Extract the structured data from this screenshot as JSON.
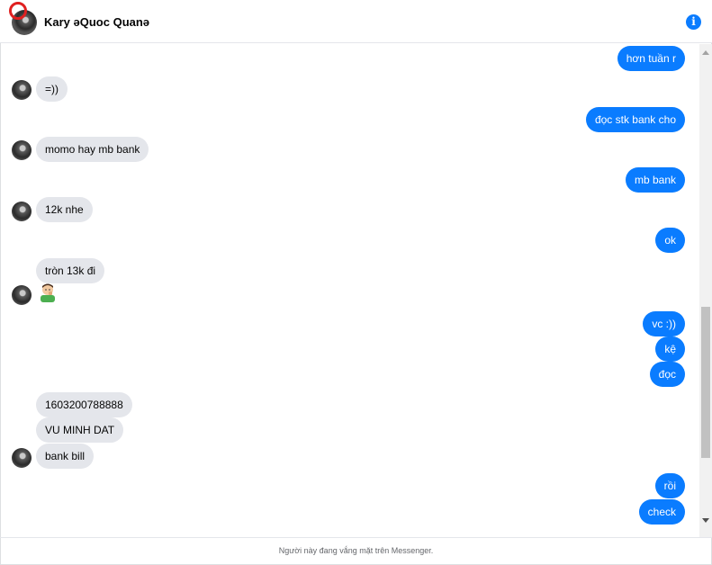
{
  "header": {
    "contact_name": "Kary ǝQuoc Quanǝ",
    "info_icon": "info-icon",
    "info_glyph": "i"
  },
  "messages": [
    {
      "side": "out",
      "text": "hơn tuần r"
    },
    {
      "side": "in",
      "text": "=))"
    },
    {
      "side": "out",
      "text": "đọc stk bank cho"
    },
    {
      "side": "in",
      "text": "momo hay mb bank"
    },
    {
      "side": "out",
      "text": "mb bank"
    },
    {
      "side": "in",
      "text": "12k nhe"
    },
    {
      "side": "out",
      "text": "ok"
    },
    {
      "side": "in",
      "text": "tròn 13k đi"
    },
    {
      "side": "in",
      "emoji": "thinking-emoji"
    },
    {
      "side": "out",
      "text": "vc :))"
    },
    {
      "side": "out",
      "text": "kệ"
    },
    {
      "side": "out",
      "text": "đọc"
    },
    {
      "side": "in",
      "text": "1603200788888"
    },
    {
      "side": "in",
      "text": "VU MINH DAT"
    },
    {
      "side": "in",
      "text": "bank bill"
    },
    {
      "side": "out",
      "text": "rồi"
    },
    {
      "side": "out",
      "text": "check"
    }
  ],
  "footer": {
    "status_text": "Người này đang vắng mặt trên Messenger."
  },
  "colors": {
    "outgoing_bubble": "#0a7cff",
    "incoming_bubble": "#e4e6eb",
    "unread_ring": "#e02020"
  }
}
